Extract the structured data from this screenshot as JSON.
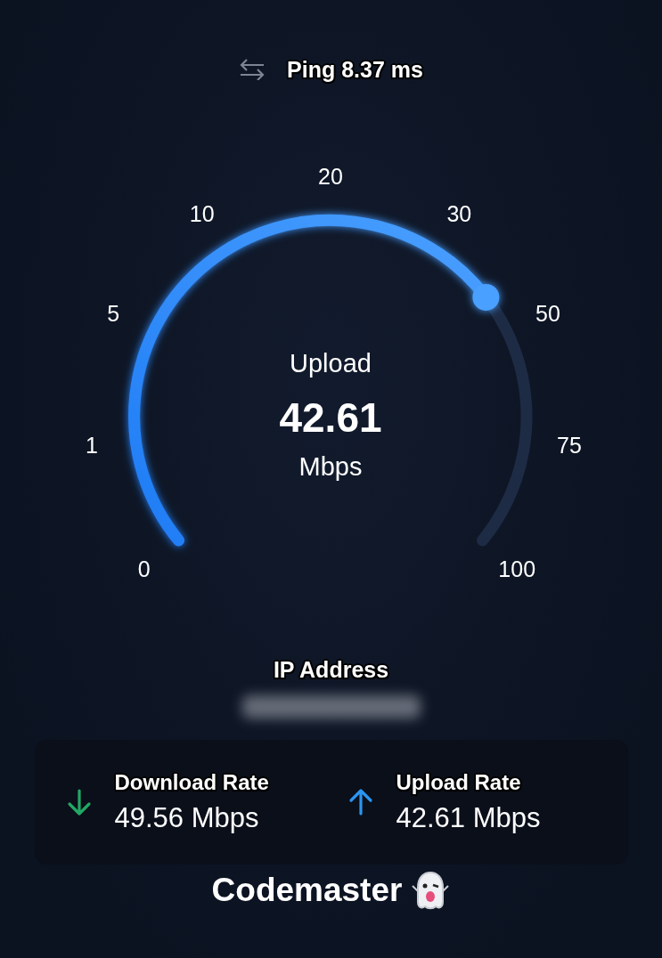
{
  "ping": {
    "label": "Ping 8.37 ms"
  },
  "gauge": {
    "mode": "Upload",
    "value": "42.61",
    "unit": "Mbps",
    "ticks": [
      "0",
      "1",
      "5",
      "10",
      "20",
      "30",
      "50",
      "75",
      "100"
    ]
  },
  "ip": {
    "label": "IP Address",
    "blurred": true
  },
  "rates": [
    {
      "kind": "download",
      "label": "Download Rate",
      "value": "49.56 Mbps"
    },
    {
      "kind": "upload",
      "label": "Upload Rate",
      "value": "42.61 Mbps"
    }
  ],
  "footer": {
    "text": "Codemaster"
  }
}
